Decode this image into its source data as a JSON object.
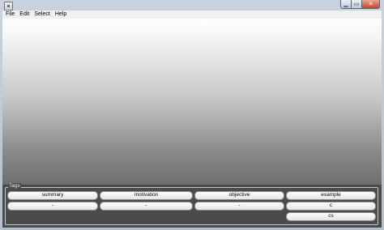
{
  "window": {
    "icon": "app-window-icon",
    "controls": {
      "minimize_icon": "minimize-icon",
      "maximize_icon": "maximize-icon",
      "close_icon": "close-icon",
      "minimize_glyph": "▁",
      "maximize_glyph": "▭",
      "close_glyph": "✕"
    }
  },
  "menubar": {
    "items": [
      "File",
      "Edit",
      "Select",
      "Help"
    ]
  },
  "canvas": {
    "gradient_colors": [
      "#ffffff",
      "#6e6e6e"
    ]
  },
  "tags_panel": {
    "title": "Tags",
    "columns": [
      {
        "tag": "summary",
        "values": [
          "-"
        ]
      },
      {
        "tag": "motivation",
        "values": [
          "-"
        ]
      },
      {
        "tag": "objective",
        "values": [
          "-"
        ]
      },
      {
        "tag": "example",
        "values": [
          "c",
          "cs"
        ]
      }
    ]
  }
}
